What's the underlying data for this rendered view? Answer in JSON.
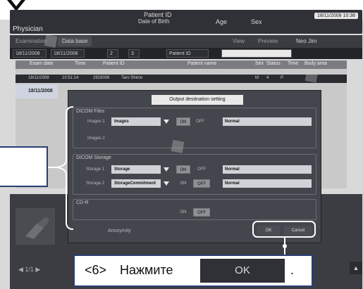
{
  "header": {
    "patient_id_label": "Patient ID",
    "dob_label": "Date of Birth",
    "age_label": "Age",
    "sex_label": "Sex",
    "user_role": "Physician",
    "datetime": "18/11/2008 10:38"
  },
  "tabs": [
    {
      "label": "Examination"
    },
    {
      "label": "Data base"
    }
  ],
  "toolbar": {
    "user_label": "Neo Jim",
    "view_label": "View",
    "preview_label": "Preview"
  },
  "filter": {
    "date_from": "18/11/2008",
    "date_to": "18/11/2008",
    "count_a": "2",
    "count_b": "3",
    "field": "Patient ID"
  },
  "table": {
    "columns": [
      "Exam date",
      "Time",
      "Patient ID",
      "Patient name",
      "Sex",
      "Status",
      "Time",
      "Body area"
    ],
    "rows": [
      {
        "date": "18/11/2008",
        "time": "10:51:14",
        "id": "2918008",
        "name": "Taro Shimo",
        "sex": "M",
        "col6": "4",
        "col7": "P"
      },
      {
        "date": "18/11/2008"
      }
    ]
  },
  "dialog": {
    "title": "Output destination setting",
    "dicom_files": {
      "label": "DICOM Files",
      "rows": [
        {
          "label": "Images 1",
          "value": "Images",
          "on": "ON",
          "off": "OFF",
          "mode": "Normal"
        },
        {
          "label": "Images 2"
        }
      ]
    },
    "dicom_storage": {
      "label": "DICOM Storage",
      "rows": [
        {
          "label": "Storage 1",
          "value": "Storage",
          "on": "ON",
          "off": "OFF",
          "mode": "Normal"
        },
        {
          "label": "Storage 2",
          "value": "StorageCommitment",
          "on": "ON",
          "off": "OFF",
          "mode": "Normal"
        }
      ]
    },
    "cd_r": {
      "label": "CD-R",
      "on": "ON",
      "off": "OFF"
    },
    "anonymity_label": "Anonymity",
    "ok_label": "OK",
    "cancel_label": "Cancel"
  },
  "left_callout": {
    "text": "."
  },
  "callout": {
    "step": "<6>",
    "verb": "Нажмите",
    "button_label": "OK",
    "period": "."
  },
  "bottom": {
    "nav": "◀  1/1  ▶",
    "right_button": "▲"
  },
  "colors": {
    "callout_border": "#283f73",
    "panel_dark": "#2f3136"
  }
}
